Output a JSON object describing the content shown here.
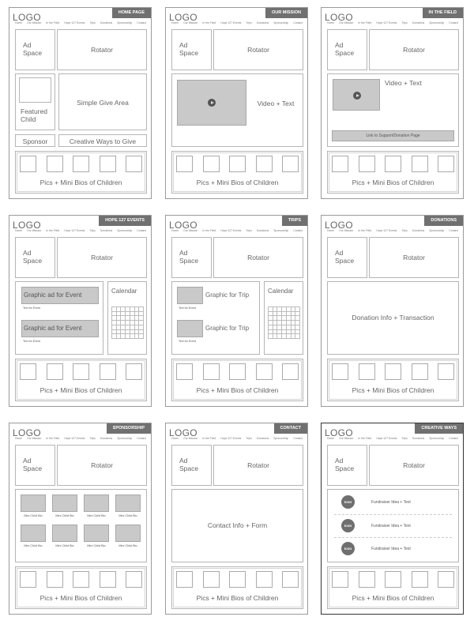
{
  "common": {
    "logo": "LOGO",
    "nav": [
      "Home",
      "Our Mission",
      "In the Field",
      "Hope 127 Events",
      "Trips",
      "Donations",
      "Sponsorship",
      "Contact"
    ],
    "ad_space_line1": "Ad",
    "ad_space_line2": "Space",
    "rotator": "Rotator",
    "pics_bios": "Pics + Mini Bios of Children"
  },
  "home": {
    "tag": "HOME PAGE",
    "featured_line1": "Featured",
    "featured_line2": "Child",
    "simple_give": "Simple Give Area",
    "sponsor": "Sponsor",
    "creative_ways": "Creative Ways to Give"
  },
  "mission": {
    "tag": "OUR MISSION",
    "video_text": "Video + Text"
  },
  "field": {
    "tag": "IN THE FIELD",
    "video_text": "Video + Text",
    "link_bar": "Link to Support/Donation Page"
  },
  "events": {
    "tag": "HOPE 127 EVENTS",
    "graphic1": "Graphic ad for Event",
    "text1": "Text for Event",
    "graphic2": "Graphic ad for Event",
    "text2": "Text for Event",
    "calendar": "Calendar"
  },
  "trips": {
    "tag": "TRIPS",
    "graphic1": "Graphic for Trip",
    "text1": "Text for Event",
    "graphic2": "Graphic for Trip",
    "text2": "Text for Event",
    "calendar": "Calendar"
  },
  "donations": {
    "tag": "DONATIONS",
    "info": "Donation Info + Transaction"
  },
  "sponsorship": {
    "tag": "SPONSORSHIP",
    "mini_bio": "Mini Child Bio"
  },
  "contact": {
    "tag": "CONTACT",
    "info": "Contact Info + Form"
  },
  "creative": {
    "tag": "CREATIVE WAYS",
    "icon_label": "Icon",
    "idea": "Fundraiser Idea + Text"
  }
}
